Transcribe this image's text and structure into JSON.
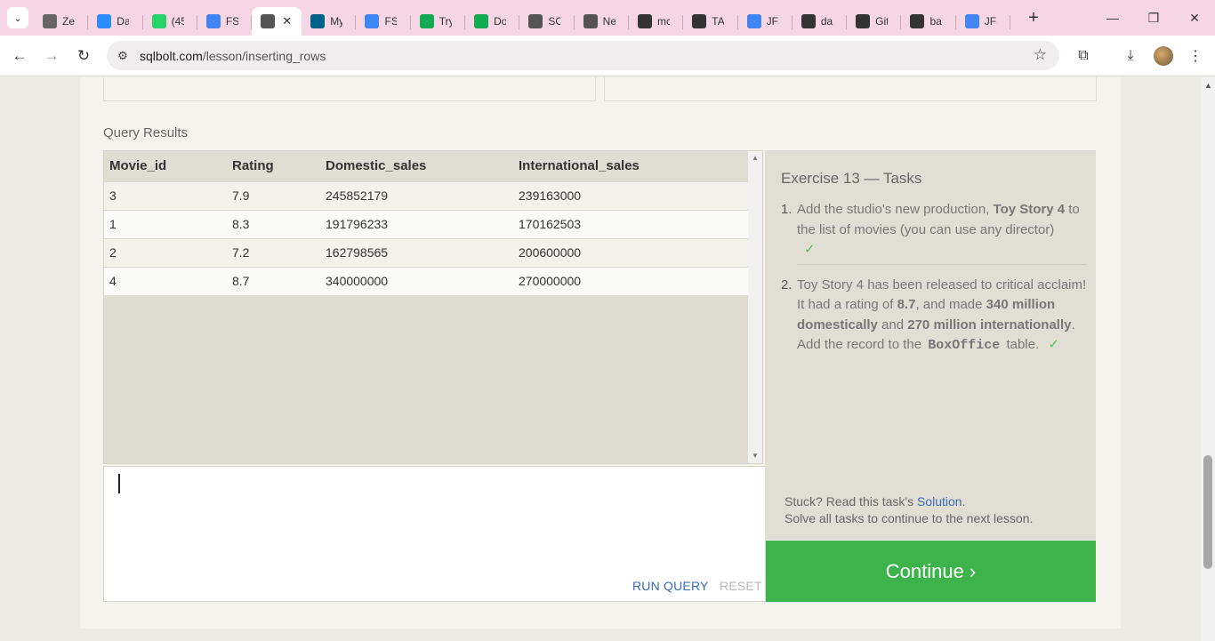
{
  "browser": {
    "tabs": [
      {
        "title": "Zei",
        "icon": "zeit-icon",
        "color": "#666666"
      },
      {
        "title": "Da",
        "icon": "zoom-icon",
        "color": "#2d8cff"
      },
      {
        "title": "(45",
        "icon": "whatsapp-icon",
        "color": "#25d366"
      },
      {
        "title": "FSI",
        "icon": "docs-icon",
        "color": "#4285f4"
      },
      {
        "title": "",
        "icon": "sqlbolt-icon",
        "color": "#555555",
        "active": true
      },
      {
        "title": "My",
        "icon": "mysql-icon",
        "color": "#00618a"
      },
      {
        "title": "FSI",
        "icon": "docs-icon",
        "color": "#4285f4"
      },
      {
        "title": "Try",
        "icon": "mongodb-icon",
        "color": "#13aa52"
      },
      {
        "title": "Do",
        "icon": "mongodb-icon",
        "color": "#13aa52"
      },
      {
        "title": "SC",
        "icon": "database-icon",
        "color": "#555555"
      },
      {
        "title": "Ne",
        "icon": "chrome-icon",
        "color": "#555555"
      },
      {
        "title": "mc",
        "icon": "github-icon",
        "color": "#333333"
      },
      {
        "title": "TA",
        "icon": "github-icon",
        "color": "#333333"
      },
      {
        "title": "JFS",
        "icon": "docs-icon",
        "color": "#4285f4"
      },
      {
        "title": "da",
        "icon": "github-icon",
        "color": "#333333"
      },
      {
        "title": "Git",
        "icon": "github-icon",
        "color": "#333333"
      },
      {
        "title": "ba",
        "icon": "github-icon",
        "color": "#333333"
      },
      {
        "title": "JFS",
        "icon": "docs-icon",
        "color": "#4285f4"
      }
    ],
    "url_host": "sqlbolt.com",
    "url_path": "/lesson/inserting_rows"
  },
  "results": {
    "label": "Query Results",
    "columns": [
      "Movie_id",
      "Rating",
      "Domestic_sales",
      "International_sales"
    ],
    "rows": [
      [
        "3",
        "7.9",
        "245852179",
        "239163000"
      ],
      [
        "1",
        "8.3",
        "191796233",
        "170162503"
      ],
      [
        "2",
        "7.2",
        "162798565",
        "200600000"
      ],
      [
        "4",
        "8.7",
        "340000000",
        "270000000"
      ]
    ]
  },
  "editor": {
    "run_label": "RUN QUERY",
    "reset_label": "RESET"
  },
  "tasks": {
    "title": "Exercise 13 — Tasks",
    "task1": {
      "num": "1.",
      "p1": "Add the studio's new production, ",
      "b1": "Toy Story 4",
      "p2": " to the list of movies (you can use any director)",
      "check": "✓"
    },
    "task2": {
      "num": "2.",
      "p1": "Toy Story 4 has been released to critical acclaim! It had a rating of ",
      "b1": "8.7",
      "p2": ", and made ",
      "b2": "340 million domestically",
      "p3": " and ",
      "b3": "270 million internationally",
      "p4": ". Add the record to the ",
      "code": "BoxOffice",
      "p5": " table.",
      "check": "✓"
    },
    "stuck_prefix": "Stuck? Read this task's ",
    "solution_link": "Solution",
    "stuck_suffix": ".",
    "solve_all": "Solve all tasks to continue to the next lesson."
  },
  "continue_label": "Continue ›",
  "colors": {
    "continue_green": "#3cb44b",
    "link_blue": "#3a69b3",
    "check_green": "#5cc05c"
  }
}
